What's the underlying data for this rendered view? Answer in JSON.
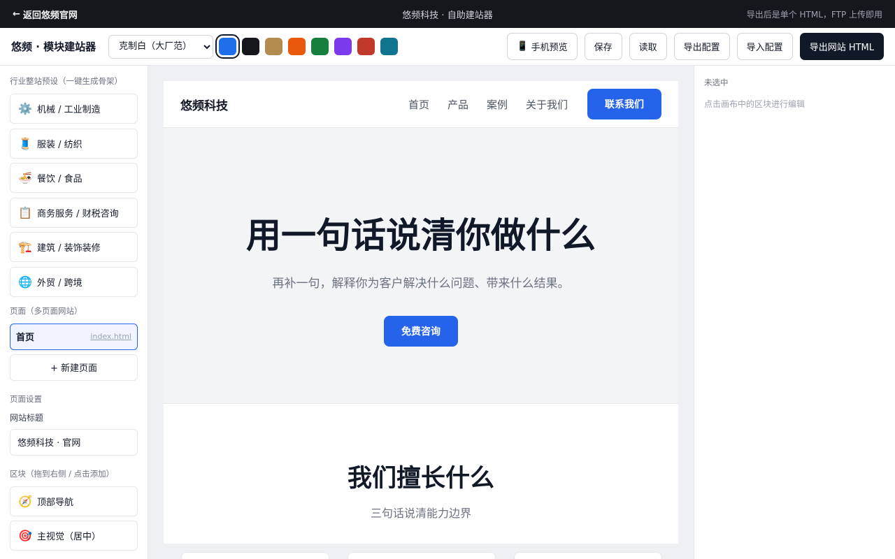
{
  "topbar": {
    "back_label": "返回悠频官网",
    "center_title": "悠频科技 · 自助建站器",
    "hint": "导出后是单个 HTML，FTP 上传即用"
  },
  "toolbar": {
    "brand": "悠频 · 模块建站器",
    "theme_selected": "克制白（大厂范）",
    "swatches": [
      "#1f6feb",
      "#15171c",
      "#b38b4f",
      "#ea580c",
      "#15803d",
      "#7c3aed",
      "#c2392b",
      "#0e7490"
    ],
    "selected_swatch": 0,
    "buttons": {
      "mobile_preview": "手机预览",
      "save": "保存",
      "load": "读取",
      "export_config": "导出配置",
      "import_config": "导入配置",
      "export_html": "导出网站 HTML"
    }
  },
  "sidebar": {
    "presets_label": "行业整站预设（一键生成骨架）",
    "presets": [
      {
        "icon": "⚙️",
        "label": "机械 / 工业制造"
      },
      {
        "icon": "🧵",
        "label": "服装 / 纺织"
      },
      {
        "icon": "🍜",
        "label": "餐饮 / 食品"
      },
      {
        "icon": "📋",
        "label": "商务服务 / 财税咨询"
      },
      {
        "icon": "🏗️",
        "label": "建筑 / 装饰装修"
      },
      {
        "icon": "🌐",
        "label": "外贸 / 跨境"
      }
    ],
    "pages_label": "页面（多页面网站）",
    "pages": [
      {
        "name": "首页",
        "file": "index.html"
      }
    ],
    "new_page_label": "+ 新建页面",
    "page_settings_label": "页面设置",
    "site_title_label": "网站标题",
    "site_title_value": "悠频科技 · 官网",
    "blocks_label": "区块（拖到右侧 / 点击添加）",
    "blocks": [
      {
        "icon": "🧭",
        "label": "顶部导航"
      },
      {
        "icon": "🎯",
        "label": "主视觉（居中）"
      }
    ]
  },
  "canvas": {
    "nav": {
      "logo": "悠频科技",
      "links": [
        "首页",
        "产品",
        "案例",
        "关于我们"
      ],
      "cta": "联系我们"
    },
    "hero": {
      "title": "用一句话说清你做什么",
      "subtitle": "再补一句，解释你为客户解决什么问题、带来什么结果。",
      "button": "免费咨询"
    },
    "services": {
      "title": "我们擅长什么",
      "subtitle": "三句话说清能力边界"
    }
  },
  "inspector": {
    "title": "未选中",
    "hint": "点击画布中的区块进行编辑"
  }
}
